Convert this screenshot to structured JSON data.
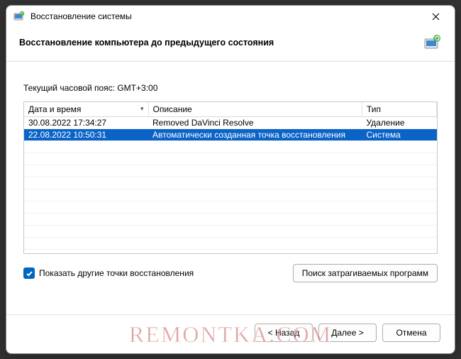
{
  "titlebar": {
    "text": "Восстановление системы"
  },
  "header": {
    "title": "Восстановление компьютера до предыдущего состояния"
  },
  "timezone_line": "Текущий часовой пояс: GMT+3:00",
  "table": {
    "headers": {
      "date": "Дата и время",
      "desc": "Описание",
      "type": "Тип"
    },
    "rows": [
      {
        "date": "30.08.2022 17:34:27",
        "desc": "Removed DaVinci Resolve",
        "type": "Удаление",
        "selected": false
      },
      {
        "date": "22.08.2022 10:50:31",
        "desc": "Автоматически созданная точка восстановления",
        "type": "Система",
        "selected": true
      }
    ]
  },
  "checkbox": {
    "label": "Показать другие точки восстановления",
    "checked": true
  },
  "buttons": {
    "scan": "Поиск затрагиваемых программ",
    "back": "< Назад",
    "next": "Далее >",
    "cancel": "Отмена"
  },
  "watermark": "REMONTKA.COM"
}
